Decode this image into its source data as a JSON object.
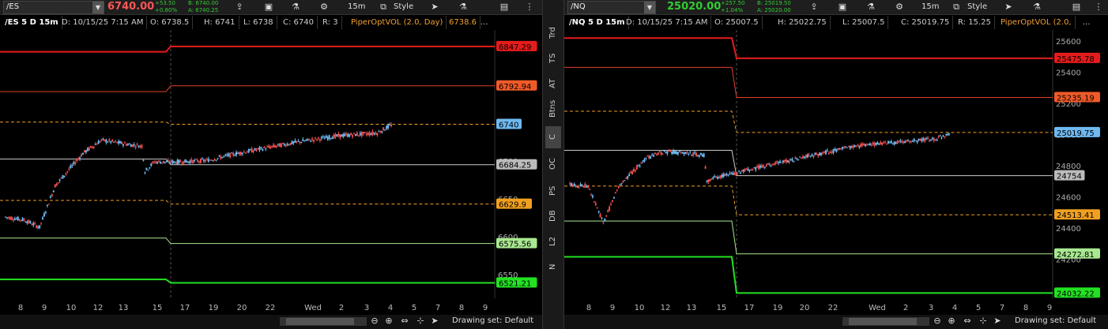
{
  "left": {
    "symbol": "/ES",
    "price": "6740.00",
    "change": "+53.50",
    "change_pct": "+0.80%",
    "bid": "B: 6740.00",
    "ask": "A: 6740.25",
    "timeframe": "15m",
    "style": "Style",
    "info": {
      "symbol": "/ES 5 D 15m",
      "date": "D: 10/15/25 7:15 AM",
      "open": "O: 6738.5",
      "high": "H: 6741",
      "low": "L: 6738",
      "close": "C: 6740",
      "range": "R: 3",
      "study": "PiperOptVOL (2.0, Day)",
      "study_val": "6738.6",
      "more": "..."
    },
    "axis_ticks": [
      "6750",
      "6700",
      "6650",
      "6600",
      "6550"
    ],
    "x_ticks": [
      "8",
      "9",
      "10",
      "12",
      "13",
      "15",
      "17",
      "19",
      "20",
      "22",
      "Wed",
      "2",
      "3",
      "4",
      "5",
      "7",
      "8",
      "9"
    ],
    "level_labels": [
      {
        "text": "6847.29",
        "color": "#e51c1c"
      },
      {
        "text": "6792.94",
        "color": "#f05a28"
      },
      {
        "text": "6740",
        "color": "#6fb8f0"
      },
      {
        "text": "6684.25",
        "color": "#bbbbbb"
      },
      {
        "text": "6629.9",
        "color": "#f0a020"
      },
      {
        "text": "6575.56",
        "color": "#a8e890"
      },
      {
        "text": "6521.21",
        "color": "#22e222"
      }
    ],
    "drawing_set": "Drawing set: Default",
    "chart_data": {
      "type": "candlestick",
      "ylim": [
        6500,
        6870
      ],
      "levels": [
        6847.29,
        6792.94,
        6740,
        6684.25,
        6629.9,
        6575.56,
        6521.21
      ]
    }
  },
  "right": {
    "symbol": "/NQ",
    "price": "25020.00",
    "change": "+257.50",
    "change_pct": "+1.04%",
    "bid": "B: 25019.50",
    "ask": "A: 25020.00",
    "timeframe": "15m",
    "style": "Style",
    "info": {
      "symbol": "/NQ 5 D 15m",
      "date": "D: 10/15/25 7:15 AM",
      "open": "O: 25007.5",
      "high": "H: 25022.75",
      "low": "L: 25007.5",
      "close": "C: 25019.75",
      "range": "R: 15.25",
      "study": "PiperOptVOL (2.0,",
      "more": "..."
    },
    "axis_ticks": [
      "25600",
      "25400",
      "25200",
      "25000",
      "24800",
      "24600",
      "24400",
      "24200",
      "24000"
    ],
    "x_ticks": [
      "8",
      "9",
      "10",
      "12",
      "13",
      "15",
      "17",
      "19",
      "20",
      "22",
      "Wed",
      "2",
      "3",
      "4",
      "5",
      "7",
      "8",
      "9"
    ],
    "level_labels": [
      {
        "text": "25475.78",
        "color": "#e51c1c"
      },
      {
        "text": "25235.19",
        "color": "#f05a28"
      },
      {
        "text": "25019.75",
        "color": "#6fb8f0"
      },
      {
        "text": "24754",
        "color": "#bbbbbb"
      },
      {
        "text": "24513.41",
        "color": "#f0a020"
      },
      {
        "text": "24272.81",
        "color": "#a8e890"
      },
      {
        "text": "24032.22",
        "color": "#22e222"
      }
    ],
    "drawing_set": "Drawing set: Default",
    "chart_data": {
      "type": "candlestick",
      "ylim": [
        24000,
        25650
      ],
      "levels": [
        25475.78,
        25235.19,
        25019.75,
        24754,
        24513.41,
        24272.81,
        24032.22
      ]
    }
  },
  "sidebar_tabs": [
    "Trd",
    "TS",
    "AT",
    "Btns",
    "C",
    "OC",
    "PS",
    "DB",
    "L2",
    "N"
  ],
  "colors": {
    "up": "#6fb8f0",
    "down": "#f05050",
    "bg": "#000000"
  }
}
